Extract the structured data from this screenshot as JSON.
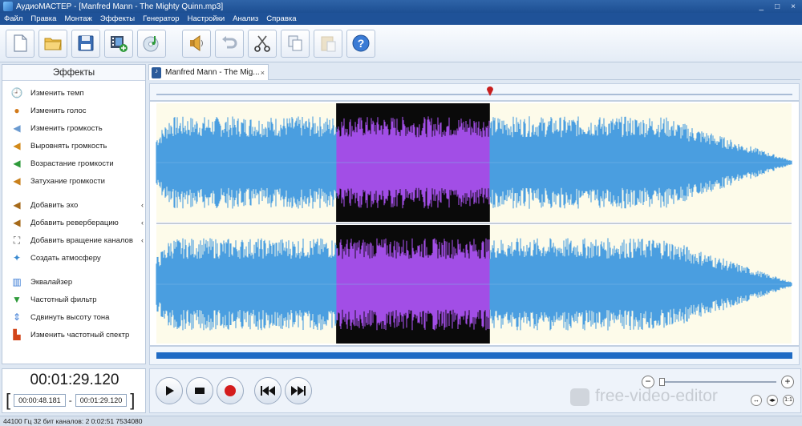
{
  "window": {
    "title": "АудиоМАСТЕР - [Manfred Mann - The Mighty Quinn.mp3]",
    "controls": [
      "_",
      "□",
      "×"
    ]
  },
  "menu": [
    "Файл",
    "Правка",
    "Монтаж",
    "Эффекты",
    "Генератор",
    "Настройки",
    "Анализ",
    "Справка"
  ],
  "toolbar": {
    "buttons": [
      "new-file",
      "open-folder",
      "save",
      "add-video",
      "cd-music",
      "speaker-effect",
      "undo",
      "cut",
      "copy",
      "paste",
      "help"
    ]
  },
  "effects_panel": {
    "header": "Эффекты",
    "items": [
      {
        "label": "Изменить темп",
        "icon": "clock-icon"
      },
      {
        "label": "Изменить голос",
        "icon": "person-icon"
      },
      {
        "label": "Изменить громкость",
        "icon": "volume-icon"
      },
      {
        "label": "Выровнять громкость",
        "icon": "equalize-volume-icon"
      },
      {
        "label": "Возрастание громкости",
        "icon": "volume-up-icon"
      },
      {
        "label": "Затухание громкости",
        "icon": "volume-down-icon"
      },
      {
        "label": "Добавить эхо",
        "icon": "echo-icon"
      },
      {
        "label": "Добавить реверберацию",
        "icon": "reverb-icon"
      },
      {
        "label": "Добавить вращение каналов",
        "icon": "rotate-channels-icon"
      },
      {
        "label": "Создать атмосферу",
        "icon": "atmosphere-icon"
      },
      {
        "label": "Эквалайзер",
        "icon": "equalizer-icon"
      },
      {
        "label": "Частотный фильтр",
        "icon": "filter-icon"
      },
      {
        "label": "Сдвинуть высоту тона",
        "icon": "pitch-icon"
      },
      {
        "label": "Изменить частотный спектр",
        "icon": "spectrum-icon"
      }
    ]
  },
  "tab": {
    "label": "Manfred Mann - The Mig...",
    "close": "×"
  },
  "waveform": {
    "selection_start_fraction": 0.283,
    "selection_end_fraction": 0.525,
    "playhead_fraction": 0.525,
    "wave_color": "#4a9ee0",
    "selection_color": "#a24ee6",
    "selection_bg": "#0a0a0a",
    "bg_color": "#fdfbea"
  },
  "time": {
    "current": "00:01:29.120",
    "selection_start": "00:00:48.181",
    "dash": "-",
    "selection_end": "00:01:29.120"
  },
  "zoom": {
    "minus": "−",
    "plus": "+",
    "level": 0.0
  },
  "watermark": "free-video-editor",
  "status": "44100 Гц  32 бит  каналов: 2   0:02:51 7534080"
}
